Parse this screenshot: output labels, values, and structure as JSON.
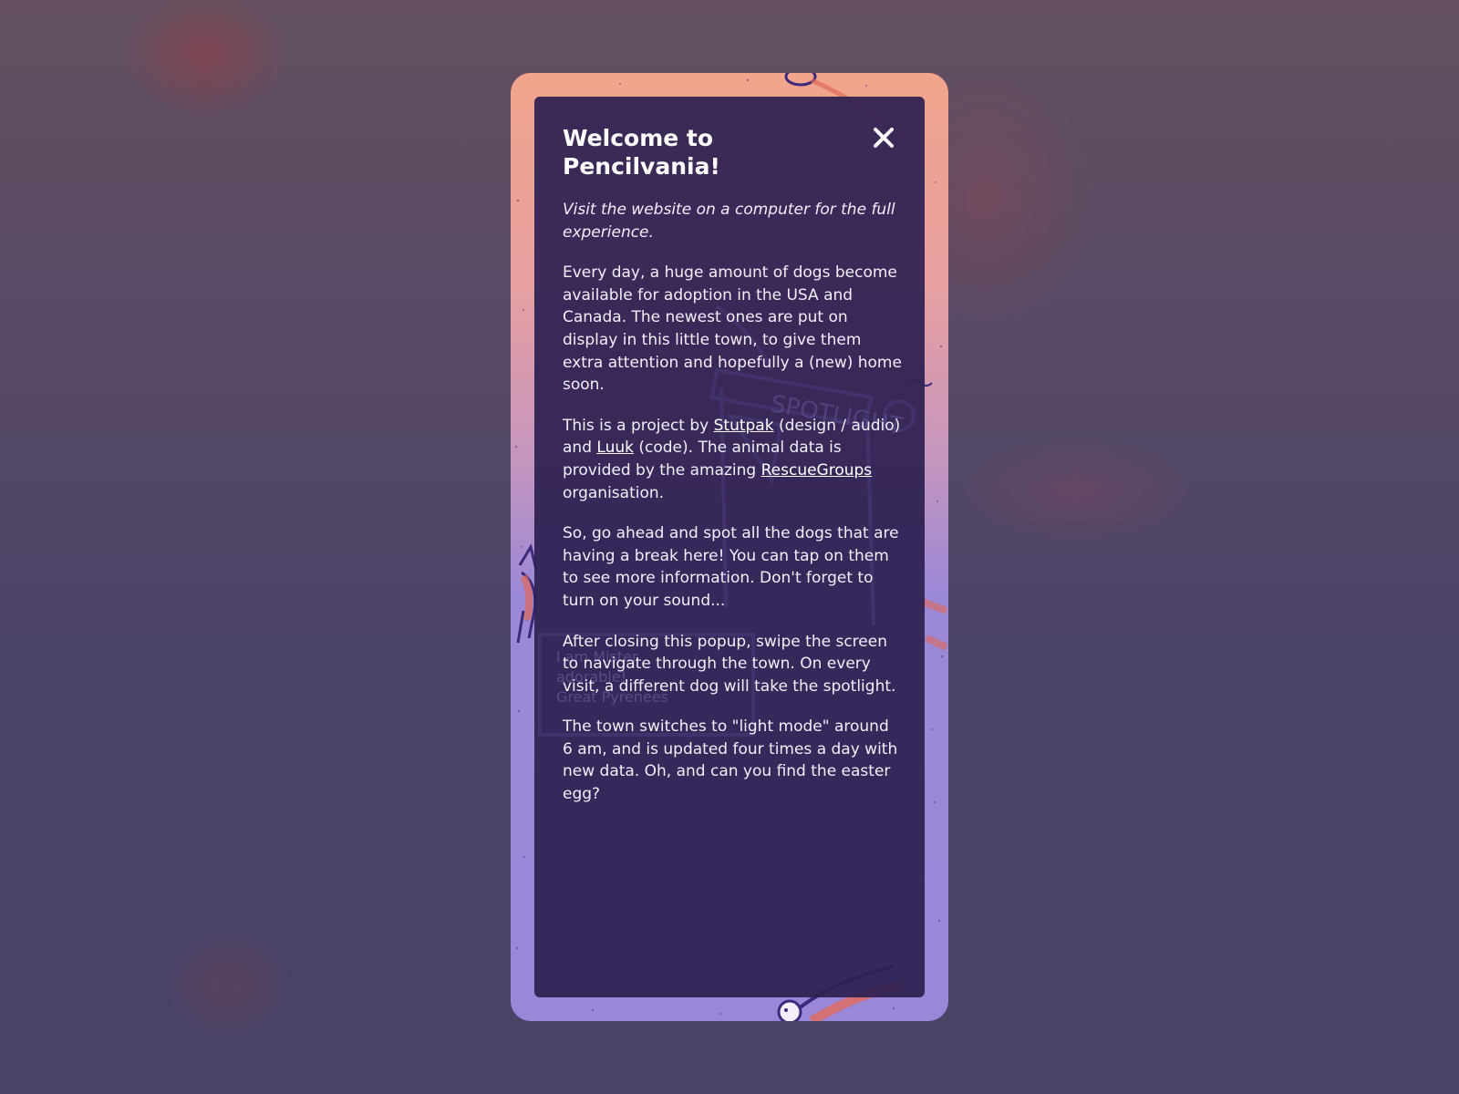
{
  "modal": {
    "title": "Welcome to Pencilvania!",
    "subtitle": "Visit the website on a computer for the full experience.",
    "paragraph_1": "Every day, a huge amount of dogs become available for adoption in the USA and Canada. The newest ones are put on display in this little town, to give them extra attention and hopefully a (new) home soon.",
    "paragraph_2": {
      "text_1": "This is a project by ",
      "link_stutpak": "Stutpak",
      "text_2": " (design / audio) and ",
      "link_luuk": "Luuk",
      "text_3": " (code). The animal data is provided by the amazing ",
      "link_rescuegroups": "RescueGroups",
      "text_4": " organisation."
    },
    "paragraph_3": "So, go ahead and spot all the dogs that are having a break here! You can tap on them to see more information. Don't forget to turn on your sound...",
    "paragraph_4": "After closing this popup, swipe the screen to navigate through the town. On every visit, a different dog will take the spotlight.",
    "paragraph_5": "The town switches to \"light mode\" around 6 am, and is updated four times a day with new data. Oh, and can you find the easter egg?",
    "close_icon": "close-icon"
  },
  "background_sign": {
    "spotlight_text": "SPOTLIGHT",
    "nameplate_line_1": "I am Mister",
    "nameplate_line_2": "adorable!",
    "nameplate_line_3": "Great Pyrenees"
  },
  "colors": {
    "frame_top": "#f2a48c",
    "frame_bottom": "#9a87d8",
    "panel": "#2d2052",
    "text": "#f3eef8",
    "backdrop": "#4c4368"
  }
}
